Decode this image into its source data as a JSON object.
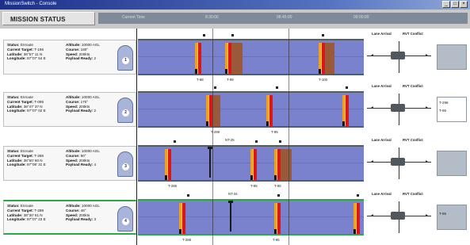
{
  "window": {
    "title": "MissionSwitch - Console"
  },
  "header": {
    "title": "MISSION STATUS",
    "ticks": [
      "Current Time",
      "8:30:00",
      "08:45:00",
      "09:00:00"
    ]
  },
  "legend": {
    "lane_arrival": "Lane Arrival",
    "rvt_conflict": "RVT Conflict"
  },
  "missions": [
    {
      "number": "1",
      "status_label": "Status:",
      "status": "Enroute",
      "target_label": "Current Target:",
      "target": "T-196",
      "lat_label": "Latitude:",
      "lat": "36°57' 11 N",
      "lon_label": "Longitude:",
      "lon": "97°07' 54 E",
      "alt_label": "Altitude:",
      "alt": "10000 AGL",
      "course_label": "Course:",
      "course": "180°",
      "speed_label": "Speed:",
      "speed": "200kts",
      "payload_label": "Payload Ready:",
      "payload": "2",
      "below": [
        "T-98",
        "T-99",
        "T-100"
      ],
      "side_tags": []
    },
    {
      "number": "2",
      "status_label": "Status:",
      "status": "Enroute",
      "target_label": "Current Target:",
      "target": "T-095",
      "lat_label": "Latitude:",
      "lat": "38°47' 37 N",
      "lon_label": "Longitude:",
      "lon": "97°07' 02 E",
      "alt_label": "Altitude:",
      "alt": "10000 AGL",
      "course_label": "Course:",
      "course": "170°",
      "speed_label": "Speed:",
      "speed": "200kts",
      "payload_label": "Payload Ready:",
      "payload": "2",
      "below": [
        "T-299",
        "T-95"
      ],
      "side_tags": [
        "T-298",
        "T-95"
      ]
    },
    {
      "number": "3",
      "status_label": "Status:",
      "status": "Enroute",
      "target_label": "Current Target:",
      "target": "T-286",
      "lat_label": "Latitude:",
      "lat": "38°50' 60 N",
      "lon_label": "Longitude:",
      "lon": "97°06' 31 E",
      "alt_label": "Altitude:",
      "alt": "10000 AGL",
      "course_label": "Course:",
      "course": "90°",
      "speed_label": "Speed:",
      "speed": "200kts",
      "payload_label": "Payload Ready:",
      "payload": "4",
      "below": [
        "T-286",
        "T-95",
        "T-95"
      ],
      "above": "NT-25",
      "side_tags": []
    },
    {
      "number": "4",
      "status_label": "Status:",
      "status": "Enroute",
      "target_label": "Current Target:",
      "target": "T-298",
      "lat_label": "Latitude:",
      "lat": "38°30' 61 N",
      "lon_label": "Longitude:",
      "lon": "97°07' 23 E",
      "alt_label": "Altitude:",
      "alt": "10000 AGL",
      "course_label": "Course:",
      "course": "46°",
      "speed_label": "Speed:",
      "speed": "200kts",
      "payload_label": "Payload Ready:",
      "payload": "3",
      "below": [
        "T-288",
        "T-95"
      ],
      "above": "NT-34",
      "side_tags": [
        "T-95"
      ]
    }
  ],
  "colors": {
    "timeline": "#7a82ce",
    "accent_green": "#2aa84a",
    "red": "#d81818",
    "orange": "#f0a020",
    "brown": "#9a5a3a"
  }
}
